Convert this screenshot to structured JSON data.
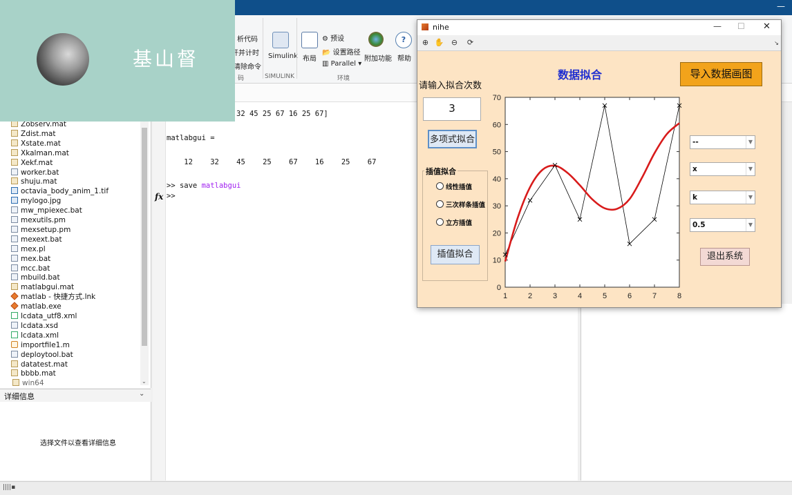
{
  "matlab_window": {
    "controls": "—"
  },
  "ribbon": {
    "code_items": [
      "析代码",
      "开并计时",
      "清除命令"
    ],
    "simulink_label": "Simulink",
    "layout_label": "布局",
    "preset_label": "预设",
    "setpath_label": "设置路径",
    "parallel_label": "Parallel",
    "addons_label": "附加功能",
    "help_label": "帮助",
    "sections": [
      "码",
      "SIMULINK",
      "环境"
    ]
  },
  "files": [
    {
      "name": "Zobserv.mat",
      "type": "mat"
    },
    {
      "name": "Zdist.mat",
      "type": "mat"
    },
    {
      "name": "Xstate.mat",
      "type": "mat"
    },
    {
      "name": "Xkalman.mat",
      "type": "mat"
    },
    {
      "name": "Xekf.mat",
      "type": "mat"
    },
    {
      "name": "worker.bat",
      "type": "file"
    },
    {
      "name": "shuju.mat",
      "type": "mat"
    },
    {
      "name": "octavia_body_anim_1.tif",
      "type": "img"
    },
    {
      "name": "mylogo.jpg",
      "type": "img"
    },
    {
      "name": "mw_mpiexec.bat",
      "type": "file"
    },
    {
      "name": "mexutils.pm",
      "type": "file"
    },
    {
      "name": "mexsetup.pm",
      "type": "file"
    },
    {
      "name": "mexext.bat",
      "type": "file"
    },
    {
      "name": "mex.pl",
      "type": "file"
    },
    {
      "name": "mex.bat",
      "type": "file"
    },
    {
      "name": "mcc.bat",
      "type": "file"
    },
    {
      "name": "mbuild.bat",
      "type": "file"
    },
    {
      "name": "matlabgui.mat",
      "type": "mat"
    },
    {
      "name": "matlab - 快捷方式.lnk",
      "type": "ml"
    },
    {
      "name": "matlab.exe",
      "type": "ml"
    },
    {
      "name": "lcdata_utf8.xml",
      "type": "xml"
    },
    {
      "name": "lcdata.xsd",
      "type": "file"
    },
    {
      "name": "lcdata.xml",
      "type": "xml"
    },
    {
      "name": "importfile1.m",
      "type": "m"
    },
    {
      "name": "deploytool.bat",
      "type": "file"
    },
    {
      "name": "datatest.mat",
      "type": "mat"
    },
    {
      "name": "bbbb.mat",
      "type": "mat"
    },
    {
      "name": "win64",
      "type": "folder"
    }
  ],
  "details": {
    "header": "详细信息",
    "empty_text": "选择文件以查看详细信息"
  },
  "command_window": {
    "line1": "32 45 25 67 16 25 67]",
    "line2": "matlabgui =",
    "line3": "    12    32    45    25    67    16    25    67",
    "line4_prompt": ">> save ",
    "line4_arg": "matlabgui",
    "line5": ">>",
    "fx": "fx"
  },
  "overlay": {
    "text": "基山督"
  },
  "figure": {
    "title": "nihe",
    "controls": {
      "minimize": "—",
      "maximize": "☐",
      "close": "✕"
    },
    "heading": "数据拟合",
    "import_button": "导入数据画图",
    "order_label": "请输入拟合次数",
    "order_value": "3",
    "poly_button": "多项式拟合",
    "interp_group_label": "插值拟合",
    "interp_options": [
      "线性插值",
      "三次样条插值",
      "立方插值"
    ],
    "interp_button": "插值拟合",
    "popups": [
      "--",
      "x",
      "k",
      "0.5"
    ],
    "exit_button": "退出系统",
    "colors": {
      "background": "#fde4c4",
      "heading": "#1f2fd0",
      "import_button": "#f2a31b",
      "fit_curve": "#d81b1b"
    }
  },
  "chart_data": {
    "type": "line",
    "title": "",
    "xlabel": "",
    "ylabel": "",
    "xlim": [
      1,
      8
    ],
    "ylim": [
      0,
      70
    ],
    "xticks": [
      1,
      2,
      3,
      4,
      5,
      6,
      7,
      8
    ],
    "yticks": [
      0,
      10,
      20,
      30,
      40,
      50,
      60,
      70
    ],
    "grid": false,
    "series": [
      {
        "x": [
          1,
          2,
          3,
          4,
          5,
          6,
          7,
          8
        ],
        "values": [
          12,
          32,
          45,
          25,
          67,
          16,
          25,
          67
        ],
        "marker": "x",
        "color": "#000000"
      },
      {
        "x": [
          1,
          1.5,
          2,
          2.5,
          3,
          3.5,
          4,
          4.5,
          5,
          5.5,
          6,
          6.5,
          7,
          7.5,
          8
        ],
        "values": [
          9.5,
          25.5,
          36.9,
          43.3,
          44.8,
          42.2,
          37.6,
          32.4,
          29.1,
          28.9,
          32.5,
          40.4,
          49.4,
          56.5,
          60.5
        ],
        "color": "#d81b1b"
      }
    ]
  }
}
